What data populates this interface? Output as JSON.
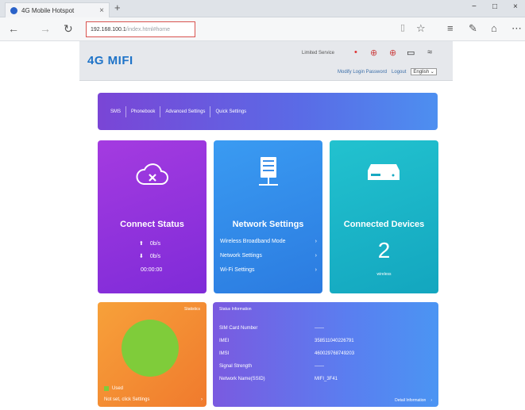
{
  "browser": {
    "tab_title": "4G Mobile Hotspot",
    "tab_close": "×",
    "new_tab": "+",
    "win_min": "−",
    "win_max": "□",
    "win_close": "×",
    "url_host": "192.168.100.1",
    "url_path": "/index.html#home"
  },
  "header": {
    "logo": "4G MIFI",
    "limited_service": "Limited Service",
    "modify_password": "Modify Login Password",
    "logout": "Logout",
    "language": "English"
  },
  "nav": {
    "items": [
      "SMS",
      "Phonebook",
      "Advanced Settings",
      "Quick Settings"
    ]
  },
  "connect": {
    "title": "Connect Status",
    "up_rate": "0b/s",
    "down_rate": "0b/s",
    "duration": "00:00:00"
  },
  "network": {
    "title": "Network Settings",
    "links": [
      "Wireless Broadband Mode",
      "Network Settings",
      "Wi-Fi Settings"
    ]
  },
  "devices": {
    "title": "Connected Devices",
    "count": "2",
    "sub": "wireless"
  },
  "statistics": {
    "label": "Statistics",
    "used_label": "Used",
    "not_set": "Not set, click Settings"
  },
  "status": {
    "heading": "Status Information",
    "rows": [
      {
        "k": "SIM Card Number",
        "v": "——"
      },
      {
        "k": "IMEI",
        "v": "358511040226791"
      },
      {
        "k": "IMSI",
        "v": "460029768749203"
      },
      {
        "k": "Signal Strength",
        "v": "——"
      },
      {
        "k": "Network Name(SSID)",
        "v": "MIFI_3F41"
      }
    ],
    "detail": "Detail Information"
  },
  "colors": {
    "accent": "#1e73c8",
    "connect": "#8e32dc",
    "network": "#3289ea",
    "devices": "#1ab3c7",
    "stats": "#f38c33",
    "pie_used": "#7fcc3a"
  }
}
